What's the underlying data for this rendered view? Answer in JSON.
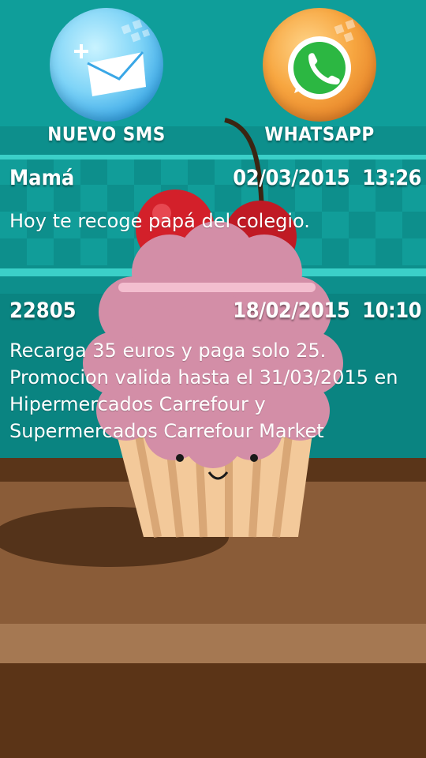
{
  "actions": {
    "sms_label": "NUEVO SMS",
    "whatsapp_label": "WHATSAPP"
  },
  "messages": [
    {
      "sender": "Mamá",
      "date": "02/03/2015",
      "time": "13:26",
      "text": "Hoy te recoge papá del colegio."
    },
    {
      "sender": "22805",
      "date": "18/02/2015",
      "time": "10:10",
      "text": "Recarga 35 euros y paga solo 25. Promocion valida hasta el 31/03/2015 en Hipermercados Carrefour y Supermercados Carrefour Market"
    }
  ],
  "colors": {
    "teal": "#0f9e9a",
    "wood": "#8a5c38",
    "frosting": "#d38ea7",
    "cherry": "#d3202a"
  }
}
